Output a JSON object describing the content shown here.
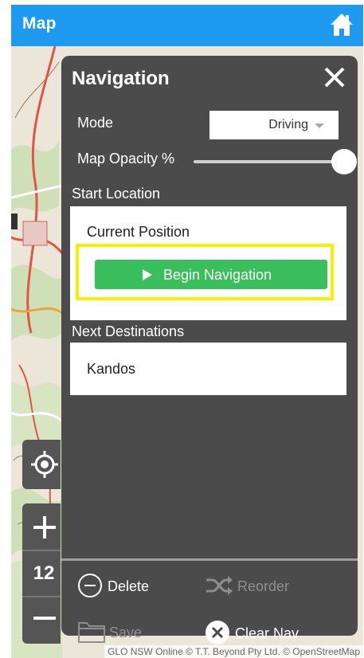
{
  "appbar": {
    "title": "Map",
    "home_icon": "home-icon",
    "color": "#1e9af0"
  },
  "panel": {
    "title": "Navigation",
    "close_icon": "close-icon",
    "mode": {
      "label": "Mode",
      "selected": "Driving"
    },
    "opacity": {
      "label": "Map Opacity %",
      "value_fraction": 1.0
    },
    "start_location": {
      "label": "Start Location",
      "value": "Current Position",
      "begin_button": "Begin Navigation"
    },
    "next_destinations": {
      "label": "Next Destinations",
      "items": [
        "Kandos"
      ]
    },
    "actions": {
      "delete": "Delete",
      "reorder": "Reorder",
      "save": "Save",
      "clear_nav": "Clear Nav"
    },
    "colors": {
      "panel_bg": "#4b4b4b",
      "begin_button": "#3bbf5c",
      "highlight": "#f5f000"
    }
  },
  "map_controls": {
    "locate_icon": "crosshair-icon",
    "zoom_in_icon": "plus-icon",
    "zoom_level": "12",
    "zoom_out_icon": "minus-icon"
  },
  "attribution": "GLO NSW Online © T.T. Beyond Pty Ltd. © OpenStreetMap"
}
